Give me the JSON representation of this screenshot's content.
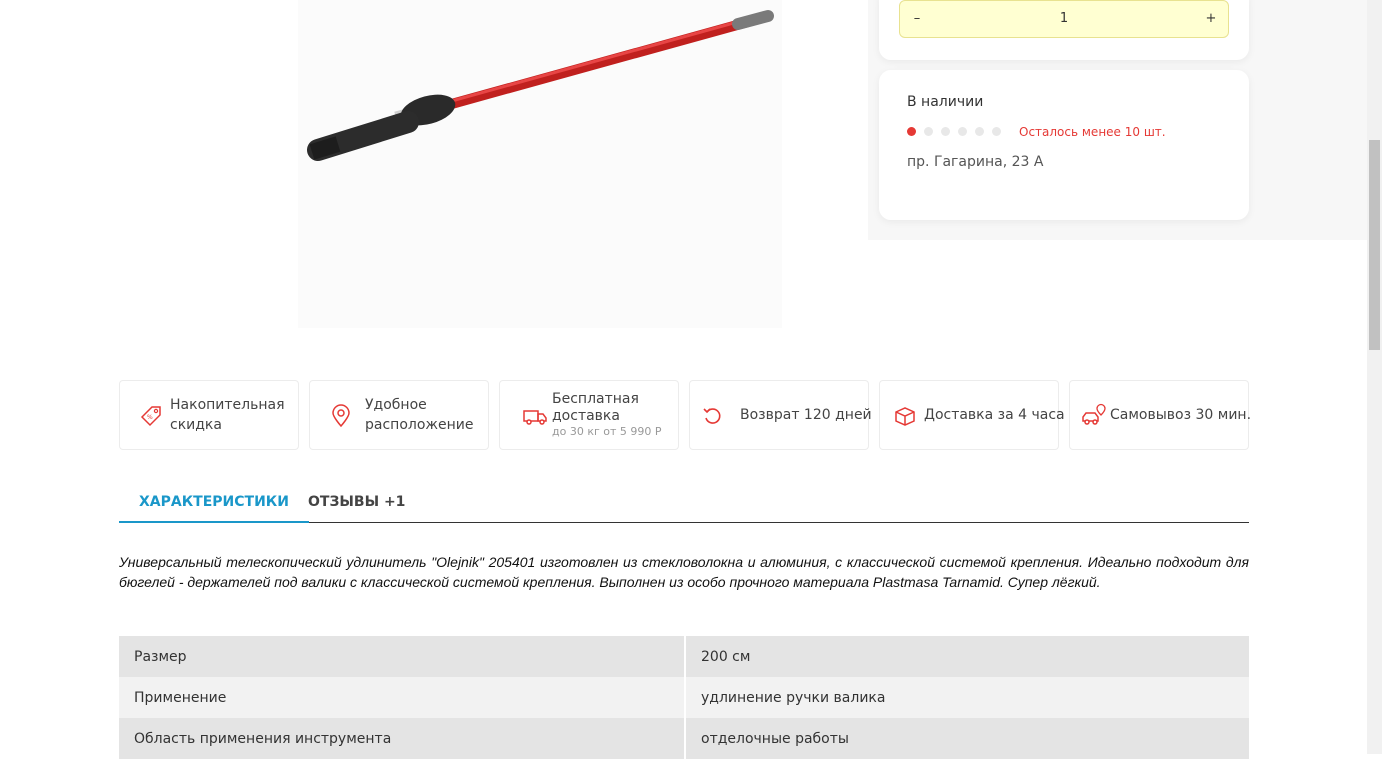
{
  "quantity": {
    "minus": "–",
    "value": "1",
    "plus": "+"
  },
  "stock": {
    "title": "В наличии",
    "level_dots_filled": 1,
    "level_dots_total": 6,
    "note": "Осталось менее 10 шт.",
    "address": "пр. Гагарина, 23 А"
  },
  "advantages": [
    {
      "icon": "discount-tag-icon",
      "label": "Накопительная скидка",
      "sub": ""
    },
    {
      "icon": "location-pin-icon",
      "label": "Удобное расположение",
      "sub": ""
    },
    {
      "icon": "delivery-truck-icon",
      "label": "Бесплатная доставка",
      "sub": "до 30 кг от 5 990 Р"
    },
    {
      "icon": "return-arrow-icon",
      "label": "Возврат 120 дней",
      "sub": ""
    },
    {
      "icon": "box-icon",
      "label": "Доставка за 4 часа",
      "sub": ""
    },
    {
      "icon": "car-pickup-icon",
      "label": "Самовывоз 30 мин.",
      "sub": ""
    }
  ],
  "tabs": [
    {
      "label": "ХАРАКТЕРИСТИКИ",
      "active": true
    },
    {
      "label": "ОТЗЫВЫ +1",
      "active": false
    }
  ],
  "description": "Универсальный телескопический удлинитель \"Olejnik\" 205401 изготовлен из стекловолокна и алюминия, с классической системой крепления. Идеально подходит для бюгелей - держателей под валики с классической системой крепления. Выполнен из особо прочного материала Plastmasa Tarnamid. Супер лёгкий.",
  "specs": [
    {
      "key": "Размер",
      "value": "200 см"
    },
    {
      "key": "Применение",
      "value": "удлинение ручки валика"
    },
    {
      "key": "Область применения инструмента",
      "value": "отделочные работы"
    }
  ],
  "colors": {
    "accent": "#1a97c9",
    "alert": "#e53935",
    "qty_bg": "#ffffd2"
  }
}
